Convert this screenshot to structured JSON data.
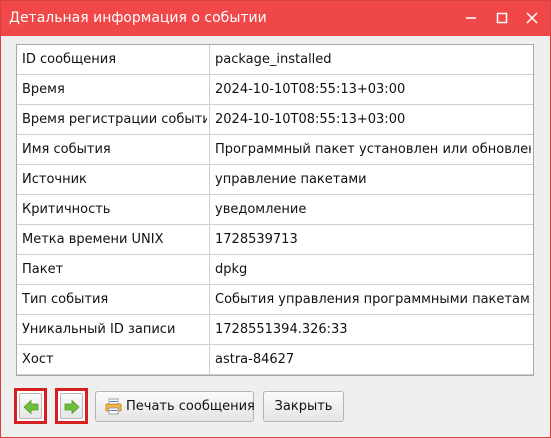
{
  "window": {
    "title": "Детальная информация о событии"
  },
  "details": {
    "rows": [
      {
        "key": "ID сообщения",
        "value": "package_installed"
      },
      {
        "key": "Время",
        "value": "2024-10-10T08:55:13+03:00"
      },
      {
        "key": "Время регистрации события",
        "value": "2024-10-10T08:55:13+03:00"
      },
      {
        "key": "Имя события",
        "value": "Программный пакет установлен или обновлен"
      },
      {
        "key": "Источник",
        "value": "управление пакетами"
      },
      {
        "key": "Критичность",
        "value": "уведомление"
      },
      {
        "key": "Метка времени UNIX",
        "value": "1728539713"
      },
      {
        "key": "Пакет",
        "value": "dpkg"
      },
      {
        "key": "Тип события",
        "value": "События управления программными пакетами"
      },
      {
        "key": "Уникальный ID записи",
        "value": "1728551394.326:33"
      },
      {
        "key": "Хост",
        "value": "astra-84627"
      }
    ]
  },
  "buttons": {
    "print_label": "Печать сообщения",
    "close_label": "Закрыть"
  },
  "icons": {
    "back": "arrow-left-icon",
    "forward": "arrow-right-icon",
    "print": "printer-icon",
    "minimize": "minimize-icon",
    "maximize": "maximize-icon",
    "close": "close-icon"
  },
  "colors": {
    "titlebar": "#f04848",
    "nav_highlight": "#d62020",
    "arrow": "#6fbf3a"
  }
}
